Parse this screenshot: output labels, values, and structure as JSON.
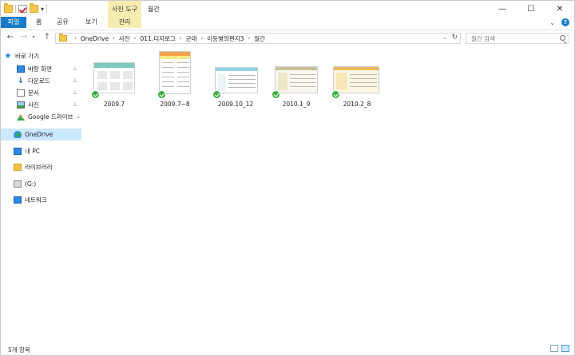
{
  "titlebar": {
    "title": "월간",
    "contextual_group": "사진 도구",
    "quick_access_dropdown": "▾",
    "window_buttons": {
      "minimize": "—",
      "maximize": "☐",
      "close": "✕"
    }
  },
  "ribbon": {
    "tabs": [
      {
        "label": "파일"
      },
      {
        "label": "홈"
      },
      {
        "label": "공유"
      },
      {
        "label": "보기"
      },
      {
        "label": "관리"
      }
    ],
    "collapse_glyph": "⌄",
    "help_glyph": "?"
  },
  "navigation": {
    "back_glyph": "←",
    "forward_glyph": "→",
    "recent_glyph": "▾",
    "up_glyph": "↑",
    "breadcrumbs": [
      "OneDrive",
      "사진",
      "011.디지로그",
      "군대",
      "이등병의편지3",
      "월간"
    ],
    "separator": "›",
    "dropdown_glyph": "⌄",
    "refresh_glyph": "↻",
    "search_placeholder": "월간 검색"
  },
  "sidebar": {
    "items": [
      {
        "label": "바로 가기",
        "icon": "star-icon",
        "pinned": false
      },
      {
        "label": "바탕 화면",
        "icon": "desktop-icon",
        "pinned": true
      },
      {
        "label": "다운로드",
        "icon": "download-icon",
        "pinned": true
      },
      {
        "label": "문서",
        "icon": "document-icon",
        "pinned": true
      },
      {
        "label": "사진",
        "icon": "pictures-icon",
        "pinned": true
      },
      {
        "label": "Google 드라이브",
        "icon": "google-drive-icon",
        "pinned": true
      },
      {
        "label": "OneDrive",
        "icon": "onedrive-icon",
        "pinned": false,
        "selected": true
      },
      {
        "label": "내 PC",
        "icon": "pc-icon",
        "pinned": false
      },
      {
        "label": "라이브러리",
        "icon": "library-icon",
        "pinned": false
      },
      {
        "label": "(G:)",
        "icon": "drive-icon",
        "pinned": false
      },
      {
        "label": "네트워크",
        "icon": "network-icon",
        "pinned": false
      }
    ],
    "pin_glyph": "📌"
  },
  "files": [
    {
      "name": "2009.7",
      "orientation": "landscape",
      "accent": "#7fc8c0",
      "sync": "synced"
    },
    {
      "name": "2009.7~8",
      "orientation": "portrait",
      "accent": "#f2a24e",
      "sync": "synced"
    },
    {
      "name": "2009.10_12",
      "orientation": "landscape",
      "accent": "#8fd3e6",
      "sync": "synced"
    },
    {
      "name": "2010.1_9",
      "orientation": "landscape",
      "accent": "#c9c29a",
      "sync": "synced"
    },
    {
      "name": "2010.2_8",
      "orientation": "landscape",
      "accent": "#e8b85a",
      "sync": "synced"
    }
  ],
  "status": {
    "item_count": "5개 항목"
  }
}
